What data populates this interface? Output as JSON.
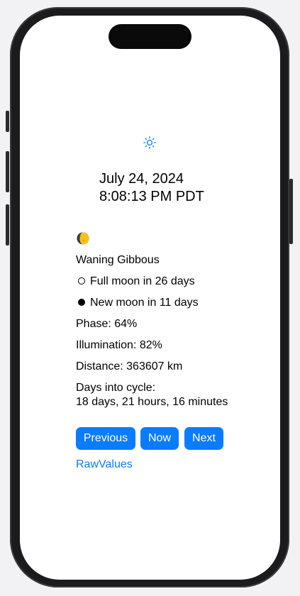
{
  "header": {
    "date": "July 24, 2024",
    "time": "8:08:13 PM PDT"
  },
  "icons": {
    "top": "sun-icon",
    "moon": "waning-gibbous-moon-icon"
  },
  "moon": {
    "phase_name": "Waning Gibbous",
    "full_moon": "Full moon in 26 days",
    "new_moon": "New moon in 11 days",
    "phase": "Phase: 64%",
    "illumination": "Illumination: 82%",
    "distance": "Distance: 363607 km",
    "cycle_label": "Days into cycle:",
    "cycle_value": "18 days, 21 hours, 16 minutes"
  },
  "buttons": {
    "previous": "Previous",
    "now": "Now",
    "next": "Next"
  },
  "link": {
    "raw_values": "RawValues"
  },
  "colors": {
    "accent": "#0a7cff",
    "moon_yellow": "#f6c21b",
    "moon_dark": "#3b3b3b"
  }
}
